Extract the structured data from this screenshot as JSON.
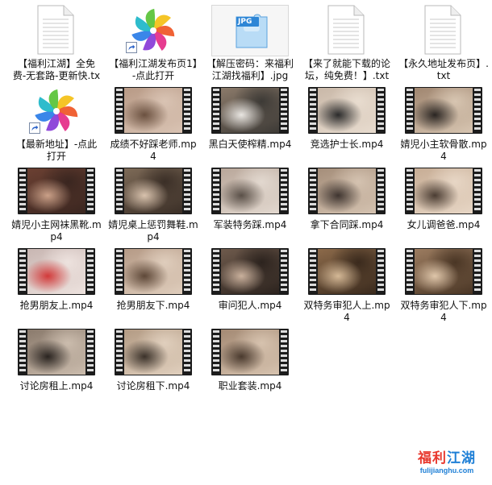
{
  "files": [
    {
      "type": "txt",
      "name": "【福利江湖】全免费-无套路-更新快.txt"
    },
    {
      "type": "shortcut",
      "name": "【福利江湖发布页1】-点此打开"
    },
    {
      "type": "jpg",
      "name": "【解压密码：来福利江湖找福利】.jpg",
      "badge": "JPG"
    },
    {
      "type": "txt",
      "name": "【来了就能下载的论坛，纯免费！】.txt"
    },
    {
      "type": "txt",
      "name": "【永久地址发布页】.txt"
    },
    {
      "type": "shortcut",
      "name": "【最新地址】-点此打开"
    },
    {
      "type": "video",
      "name": "成绩不好踩老师.mp4",
      "scene": [
        "#b89a86",
        "#6b5140",
        "#d9c3b3"
      ]
    },
    {
      "type": "video",
      "name": "黑白天使榨精.mp4",
      "scene": [
        "#8b7a6a",
        "#e9e6e2",
        "#3d3a36"
      ]
    },
    {
      "type": "video",
      "name": "竞选护士长.mp4",
      "scene": [
        "#c9b8a8",
        "#2b2b2b",
        "#e8dccf"
      ]
    },
    {
      "type": "video",
      "name": "婧児小主软骨散.mp4",
      "scene": [
        "#a08670",
        "#2a2522",
        "#d7c5b1"
      ]
    },
    {
      "type": "video",
      "name": "婧児小主网袜黑靴.mp4",
      "scene": [
        "#6b4032",
        "#caa088",
        "#3a2620"
      ]
    },
    {
      "type": "video",
      "name": "婧児桌上惩罚舞鞋.mp4",
      "scene": [
        "#7d6a57",
        "#d8c2ad",
        "#3b2f27"
      ]
    },
    {
      "type": "video",
      "name": "军装特务踩.mp4",
      "scene": [
        "#b9a79a",
        "#5a5048",
        "#e2d8cf"
      ]
    },
    {
      "type": "video",
      "name": "拿下合同踩.mp4",
      "scene": [
        "#a58e7a",
        "#3f3530",
        "#d4c2b0"
      ]
    },
    {
      "type": "video",
      "name": "女儿调爸爸.mp4",
      "scene": [
        "#c7ad95",
        "#4b3d33",
        "#e7d6c5"
      ]
    },
    {
      "type": "video",
      "name": "抢男朋友上.mp4",
      "scene": [
        "#c8b6b2",
        "#d23a3a",
        "#ede2de"
      ]
    },
    {
      "type": "video",
      "name": "抢男朋友下.mp4",
      "scene": [
        "#b59a86",
        "#5e4838",
        "#dfcdbc"
      ]
    },
    {
      "type": "video",
      "name": "审问犯人.mp4",
      "scene": [
        "#6e5a4c",
        "#c9b09c",
        "#2c231e"
      ]
    },
    {
      "type": "video",
      "name": "双特务审犯人上.mp4",
      "scene": [
        "#8c6a4a",
        "#d4b896",
        "#3a2a1d"
      ]
    },
    {
      "type": "video",
      "name": "双特务审犯人下.mp4",
      "scene": [
        "#9c7c60",
        "#dfc6aa",
        "#4a3625"
      ]
    },
    {
      "type": "video",
      "name": "讨论房租上.mp4",
      "scene": [
        "#8a7a6c",
        "#2a2420",
        "#cbbcad"
      ]
    },
    {
      "type": "video",
      "name": "讨论房租下.mp4",
      "scene": [
        "#b39b84",
        "#3b322a",
        "#e0cfbd"
      ]
    },
    {
      "type": "video",
      "name": "职业套装.mp4",
      "scene": [
        "#a48a74",
        "#4a3a2e",
        "#d6c2ae"
      ]
    }
  ],
  "watermark": {
    "title_part1": "福利",
    "title_part2": "江湖",
    "url": "fulijianghu.com",
    "color_red": "#e8382e",
    "color_blue": "#1e7fd6"
  }
}
